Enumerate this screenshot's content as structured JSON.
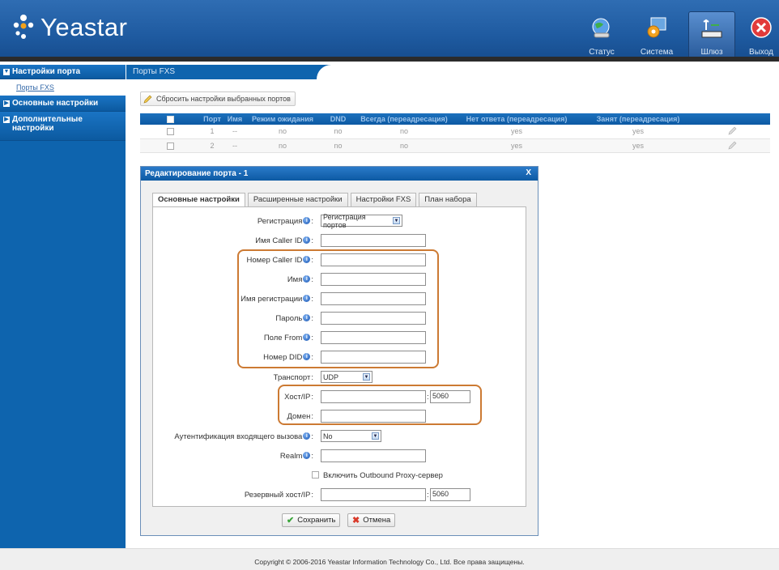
{
  "header": {
    "logo_text": "Yeastar",
    "nav": [
      {
        "label": "Статус",
        "icon": "status-globe-icon"
      },
      {
        "label": "Система",
        "icon": "system-gear-icon"
      },
      {
        "label": "Шлюз",
        "icon": "gateway-device-icon",
        "active": true
      },
      {
        "label": "Выход",
        "icon": "logout-x-icon"
      }
    ]
  },
  "sidebar": {
    "port_settings": "Настройки порта",
    "fxs_ports_link": "Порты FXS",
    "basic_settings": "Основные настройки",
    "extra_settings": "Дополнительные настройки"
  },
  "main": {
    "tab_title": "Порты FXS",
    "reset_button": "Сбросить настройки выбранных портов",
    "table": {
      "headers": [
        "Порт",
        "Имя",
        "Режим ожидания",
        "DND",
        "Всегда (переадресация)",
        "Нет ответа (переадресация)",
        "Занят (переадресация)"
      ],
      "rows": [
        [
          "1",
          "--",
          "no",
          "no",
          "no",
          "yes",
          "yes"
        ],
        [
          "2",
          "--",
          "no",
          "no",
          "no",
          "yes",
          "yes"
        ]
      ]
    }
  },
  "dialog": {
    "title": "Редактирование порта - 1",
    "close": "X",
    "tabs": [
      "Основные настройки",
      "Расширенные настройки",
      "Настройки FXS",
      "План набора"
    ],
    "fields": {
      "registration_label": "Регистрация",
      "registration_value": "Регистрация портов",
      "caller_id_name_label": "Имя Caller ID",
      "caller_id_number_label": "Номер Caller ID",
      "name_label": "Имя",
      "reg_name_label": "Имя регистрации",
      "password_label": "Пароль",
      "from_field_label": "Поле From",
      "did_label": "Номер DID",
      "transport_label": "Транспорт",
      "transport_value": "UDP",
      "host_label": "Хост/IP",
      "host_port": "5060",
      "domain_label": "Домен",
      "auth_label": "Аутентификация входящего вызова",
      "auth_value": "No",
      "realm_label": "Realm",
      "outbound_proxy_label": "Включить Outbound Proxy-сервер",
      "backup_host_label": "Резервный хост/IP",
      "backup_port": "5060"
    },
    "save": "Сохранить",
    "cancel": "Отмена"
  },
  "footer": {
    "copyright": "Copyright © 2006-2016 Yeastar Information Technology Co., Ltd. Все права защищены."
  },
  "colors": {
    "brand_blue": "#0e64ae",
    "highlight_orange": "#cc7a33"
  }
}
